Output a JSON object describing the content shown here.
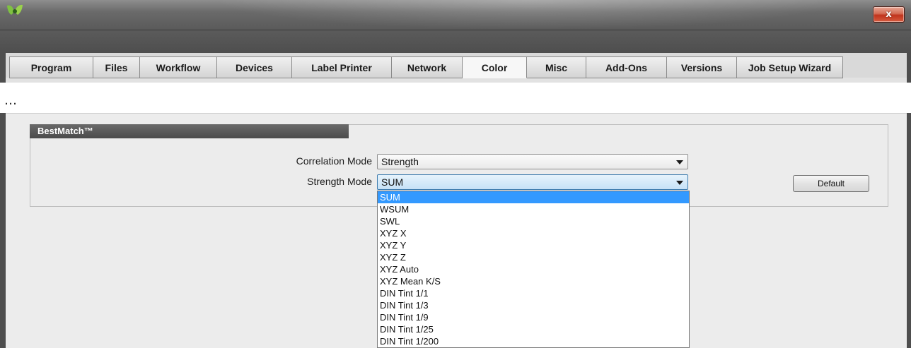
{
  "window": {
    "close_label": "x"
  },
  "tabs": [
    {
      "label": "Program"
    },
    {
      "label": "Files"
    },
    {
      "label": "Workflow"
    },
    {
      "label": "Devices"
    },
    {
      "label": "Label Printer"
    },
    {
      "label": "Network"
    },
    {
      "label": "Color",
      "active": true
    },
    {
      "label": "Misc"
    },
    {
      "label": "Add-Ons"
    },
    {
      "label": "Versions"
    },
    {
      "label": "Job Setup Wizard"
    }
  ],
  "ellipsis": "…",
  "bestmatch": {
    "title": "BestMatch™",
    "correlation_mode": {
      "label": "Correlation Mode",
      "value": "Strength"
    },
    "strength_mode": {
      "label": "Strength Mode",
      "value": "SUM",
      "options": [
        "SUM",
        "WSUM",
        "SWL",
        "XYZ X",
        "XYZ Y",
        "XYZ Z",
        "XYZ Auto",
        "XYZ Mean K/S",
        "DIN Tint 1/1",
        "DIN Tint 1/3",
        "DIN Tint 1/9",
        "DIN Tint 1/25",
        "DIN Tint 1/200"
      ]
    },
    "default_button": "Default"
  },
  "colors": {
    "selection": "#3399ff",
    "chrome": "#4e4e4e"
  }
}
